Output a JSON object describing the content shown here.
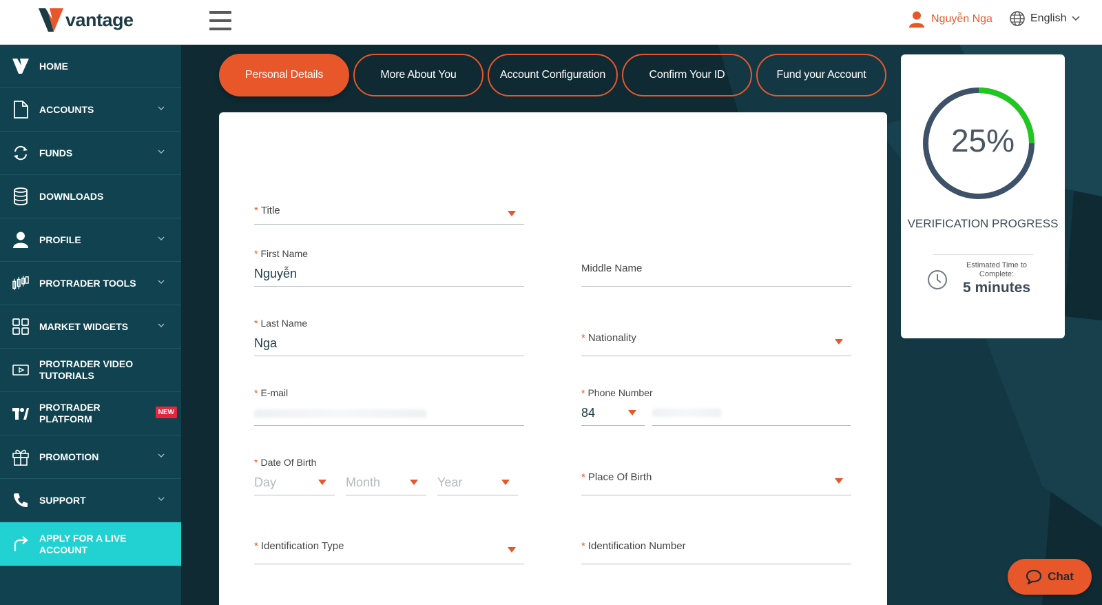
{
  "header": {
    "logo_text": "vantage",
    "user_name": "Nguyễn Nga",
    "language": "English"
  },
  "sidebar": {
    "items": [
      {
        "label": "HOME",
        "icon": "vantage-logo-icon"
      },
      {
        "label": "ACCOUNTS",
        "icon": "document-icon"
      },
      {
        "label": "FUNDS",
        "icon": "refresh-icon"
      },
      {
        "label": "DOWNLOADS",
        "icon": "database-icon"
      },
      {
        "label": "PROFILE",
        "icon": "user-icon"
      },
      {
        "label": "PROTRADER TOOLS",
        "icon": "candlestick-icon"
      },
      {
        "label": "MARKET WIDGETS",
        "icon": "grid-icon"
      },
      {
        "label": "PROTRADER VIDEO TUTORIALS",
        "icon": "video-icon"
      },
      {
        "label": "PROTRADER PLATFORM",
        "icon": "tradingview-icon",
        "badge": "NEW"
      },
      {
        "label": "PROMOTION",
        "icon": "gift-icon"
      },
      {
        "label": "SUPPORT",
        "icon": "phone-icon"
      },
      {
        "label": "APPLY FOR A LIVE ACCOUNT",
        "icon": "redirect-icon"
      }
    ]
  },
  "tabs": [
    "Personal Details",
    "More About You",
    "Account Configuration",
    "Confirm Your ID",
    "Fund your Account"
  ],
  "form": {
    "title": {
      "label": "Title",
      "value": ""
    },
    "first_name": {
      "label": "First Name",
      "value": "Nguyễn"
    },
    "middle_name": {
      "label": "Middle Name",
      "value": ""
    },
    "last_name": {
      "label": "Last Name",
      "value": "Nga"
    },
    "nationality": {
      "label": "Nationality",
      "value": ""
    },
    "email": {
      "label": "E-mail",
      "value": ""
    },
    "phone": {
      "label": "Phone Number",
      "code": "84",
      "value": ""
    },
    "dob": {
      "label": "Date Of Birth",
      "day": "Day",
      "month": "Month",
      "year": "Year"
    },
    "place_of_birth": {
      "label": "Place Of Birth",
      "value": ""
    },
    "id_type": {
      "label": "Identification Type",
      "value": ""
    },
    "id_number": {
      "label": "Identification Number",
      "value": ""
    }
  },
  "progress": {
    "percent_label": "25%",
    "percent_fraction": 0.25,
    "title": "VERIFICATION PROGRESS",
    "estimate_label": "Estimated Time to Complete:",
    "estimate_value": "5 minutes",
    "ring_color": "#3d5168",
    "fill_color": "#1fc71f"
  },
  "chat": {
    "label": "Chat"
  },
  "colors": {
    "accent": "#e8572a",
    "sidebar": "#10434f",
    "active_nav": "#22d2d2"
  }
}
